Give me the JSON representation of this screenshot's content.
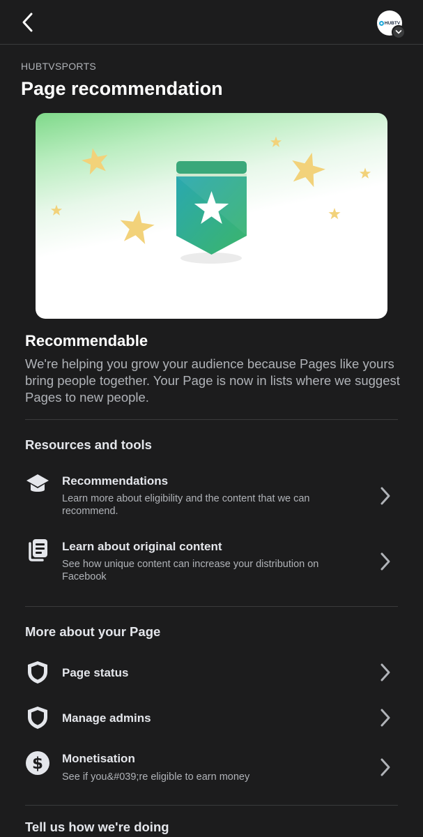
{
  "header": {
    "back_icon": "chevron-left-icon",
    "avatar_text": "HUBTV",
    "avatar_badge_icon": "chevron-down-icon"
  },
  "page": {
    "handle": "HUBTVSPORTS",
    "title": "Page recommendation"
  },
  "status": {
    "title": "Recommendable",
    "description": "We're helping you grow your audience because Pages like yours bring people together. Your Page is now in lists where we suggest Pages to new people."
  },
  "resources": {
    "heading": "Resources and tools",
    "items": [
      {
        "icon": "graduation-cap-icon",
        "title": "Recommendations",
        "subtitle": "Learn more about eligibility and the content that we can recommend."
      },
      {
        "icon": "documents-icon",
        "title": "Learn about original content",
        "subtitle": "See how unique content can increase your distribution on Facebook"
      }
    ]
  },
  "more": {
    "heading": "More about your Page",
    "items": [
      {
        "icon": "shield-icon",
        "title": "Page status"
      },
      {
        "icon": "shield-icon",
        "title": "Manage admins"
      },
      {
        "icon": "dollar-icon",
        "title": "Monetisation",
        "subtitle": "See if you&#039;re eligible to earn money"
      }
    ]
  },
  "feedback": {
    "heading": "Tell us how we're doing"
  },
  "colors": {
    "background": "#1c1c1d",
    "text_primary": "#e4e6eb",
    "text_secondary": "#b0b3b8",
    "banner_teal": "#2fae9e",
    "star_yellow": "#f2d27a"
  }
}
